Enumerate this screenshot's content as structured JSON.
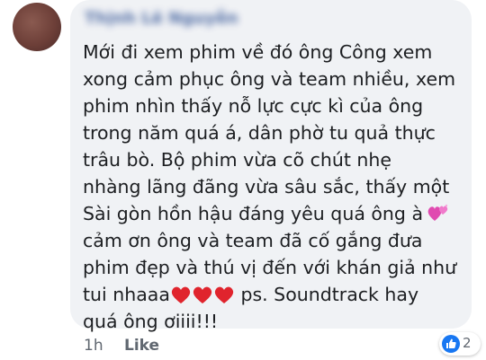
{
  "comment": {
    "author": "Thịnh Lê Nguyễn",
    "lines": [
      "Mới đi xem phim về đó ông Công xem",
      "xong cảm phục ông và team nhiều, xem",
      "phim nhìn thấy nỗ lực cực kì của ông",
      "trong năm quá á, dân phờ tu quả thực",
      "trâu bò. Bộ phim vừa cõ chút nhẹ",
      "nhàng lãng đãng vừa sâu sắc, thấy một",
      "Sài gòn hồn hậu đáng yêu quá ông à",
      "cảm ơn ông và team đã cố gắng đưa",
      "phim đẹp và thú vị đến với khán giả như",
      "tui nhaaa",
      "ps. Soundtrack hay",
      "quá ông ơiiii!!!"
    ],
    "emojis": {
      "line7": "two-hearts",
      "line10": [
        "red-heart",
        "red-heart",
        "red-heart"
      ]
    }
  },
  "footer": {
    "time": "1h",
    "like": "Like"
  },
  "reactions": {
    "icon": "like-icon",
    "count": "2"
  },
  "colors": {
    "bubble": "#f0f2f5",
    "text": "#1c1e21",
    "meta": "#606770",
    "like_blue": "#1877f2",
    "heart_red": "#e0242d",
    "heart_pink": "#e04ab0"
  }
}
